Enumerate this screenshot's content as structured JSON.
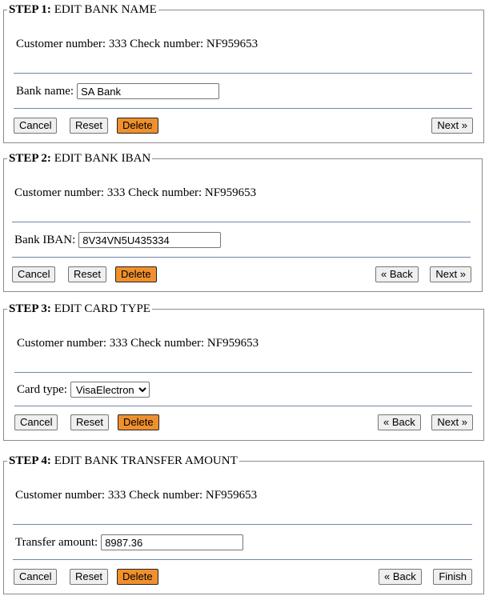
{
  "customer_label": "Customer number:",
  "customer_number": "333",
  "check_label": "Check number:",
  "check_number": "NF959653",
  "buttons": {
    "cancel": "Cancel",
    "reset": "Reset",
    "delete": "Delete",
    "back": "« Back",
    "next": "Next »",
    "finish": "Finish"
  },
  "steps": [
    {
      "number_label": "STEP 1:",
      "title": "EDIT BANK NAME",
      "field_label": "Bank name:",
      "field_value": "SA Bank"
    },
    {
      "number_label": "STEP 2:",
      "title": "EDIT BANK IBAN",
      "field_label": "Bank IBAN:",
      "field_value": "8V34VN5U435334"
    },
    {
      "number_label": "STEP 3:",
      "title": "EDIT CARD TYPE",
      "field_label": "Card type:",
      "field_value": "VisaElectron"
    },
    {
      "number_label": "STEP 4:",
      "title": "EDIT BANK TRANSFER AMOUNT",
      "field_label": "Transfer amount:",
      "field_value": "8987.36"
    }
  ]
}
